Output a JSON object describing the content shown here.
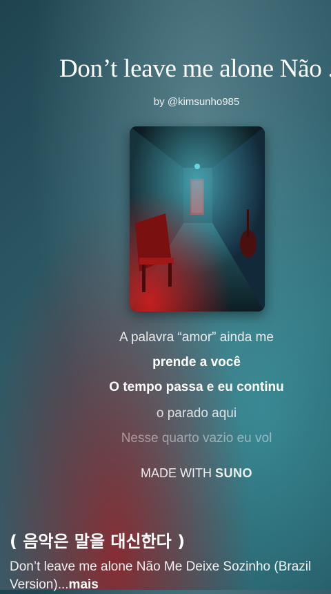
{
  "song": {
    "title": "Don’t leave me alone Não ...",
    "author": "by @kimsunho985"
  },
  "cover": {
    "icon": "hallway-cover-art"
  },
  "lyrics": [
    "A palavra “amor” ainda me",
    "prende a você",
    "O tempo passa e eu continu",
    "o parado aqui",
    "Nesse quarto vazio eu vol"
  ],
  "badge": {
    "prefix": "MADE WITH ",
    "brand": "SUNO"
  },
  "post": {
    "channel": "( 음악은 말을 대신한다 )",
    "description": "Don’t leave me alone Não Me Deixe Sozinho (Brazil Version)...",
    "more_label": "mais"
  }
}
